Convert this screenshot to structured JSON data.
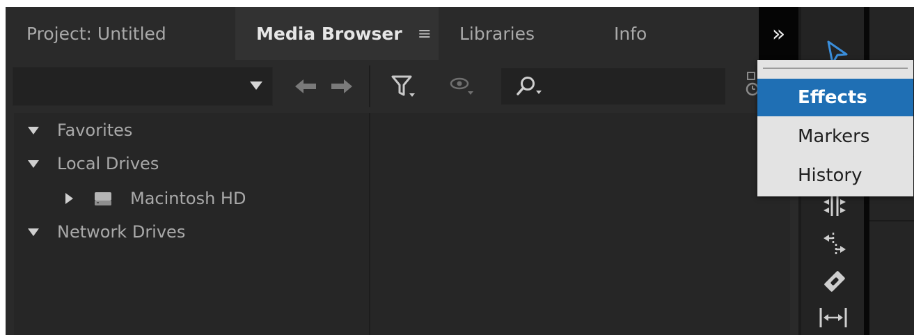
{
  "tabs": [
    {
      "label": "Project: Untitled"
    },
    {
      "label": "Media Browser",
      "menu_glyph": "≡"
    },
    {
      "label": "Libraries"
    },
    {
      "label": "Info"
    }
  ],
  "overflow_glyph": "»",
  "tree": {
    "favorites": "Favorites",
    "local_drives": "Local Drives",
    "macintosh_hd": "Macintosh HD",
    "network_drives": "Network Drives"
  },
  "menu": {
    "items": [
      {
        "label": "Effects",
        "highlighted": true
      },
      {
        "label": "Markers"
      },
      {
        "label": "History"
      }
    ]
  },
  "colors": {
    "highlight": "#1f6fb4",
    "selection_tool": "#3a8edb",
    "panel_bg": "#2a2a2a"
  },
  "icons": [
    "dropdown-caret-icon",
    "back-arrow-icon",
    "forward-arrow-icon",
    "filter-icon",
    "view-eye-icon",
    "search-icon",
    "clock-icon",
    "selection-tool-icon",
    "ripple-edit-tool-icon",
    "rolling-edit-tool-icon",
    "razor-tool-icon",
    "slip-tool-icon"
  ]
}
